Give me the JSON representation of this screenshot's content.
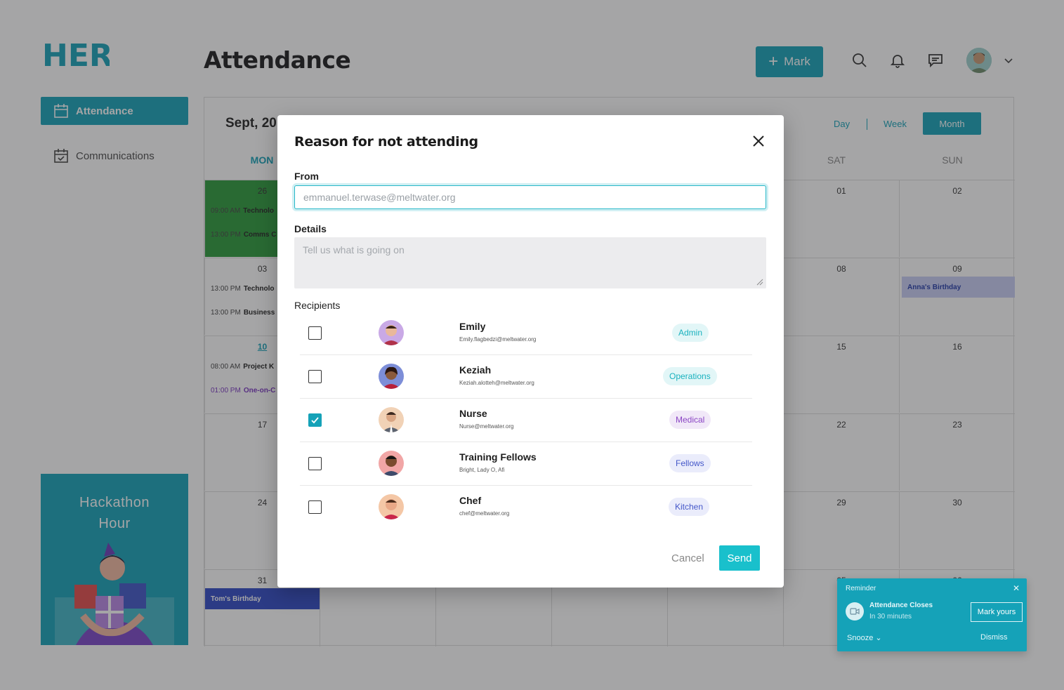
{
  "app": {
    "logo_text": "HERE",
    "page_title": "Attendance",
    "mark_button": "Mark",
    "brand_color": "#15a2b8",
    "header_icons": [
      "search-icon",
      "bell-icon",
      "chat-icon"
    ]
  },
  "sidebar": {
    "items": [
      {
        "label": "Attendance",
        "icon": "calendar-icon",
        "active": true
      },
      {
        "label": "Communications",
        "icon": "calendar-check-icon",
        "active": false
      }
    ],
    "promo_title_line1": "Hackathon",
    "promo_title_line2": "Hour"
  },
  "calendar": {
    "month_label": "Sept, 20",
    "views": {
      "day": "Day",
      "week": "Week",
      "month": "Month",
      "selected": "Month"
    },
    "weekdays": {
      "mon": "MON",
      "sat": "SAT",
      "sun": "SUN"
    },
    "mon_dates": [
      "26",
      "03",
      "10",
      "17",
      "24",
      "31"
    ],
    "sat_dates": [
      "01",
      "08",
      "15",
      "22",
      "29",
      "05"
    ],
    "sun_dates": [
      "02",
      "09",
      "16",
      "23",
      "30",
      "06"
    ],
    "events": [
      {
        "time": "09:00 AM",
        "title": "Technolo"
      },
      {
        "time": "13:00 PM",
        "title": "Comms C"
      },
      {
        "time": "13:00 PM",
        "title": "Technolo"
      },
      {
        "time": "13:00 PM",
        "title": "Business"
      },
      {
        "time": "08:00 AM",
        "title": "Project K"
      },
      {
        "time": "01:00 PM",
        "title": "One-on-C"
      }
    ],
    "birthdays": {
      "anna": "Anna's Birthday",
      "tom": "Tom's Birthday"
    }
  },
  "modal": {
    "title": "Reason for not attending",
    "from_label": "From",
    "from_placeholder": "emmanuel.terwase@meltwater.org",
    "details_label": "Details",
    "details_placeholder": "Tell us what is going on",
    "recipients_label": "Recipients",
    "recipients": [
      {
        "name": "Emily",
        "email": "Emily.flagbedzi@meltwater.org",
        "tag": "Admin",
        "checked": false,
        "tag_bg": "#e2f6f7",
        "tag_color": "#1ab2bf"
      },
      {
        "name": "Keziah",
        "email": "Keziah.alotteh@meltwater.org",
        "tag": "Operations",
        "checked": false,
        "tag_bg": "#e2f6f7",
        "tag_color": "#1ab2bf"
      },
      {
        "name": "Nurse",
        "email": "Nurse@meltwater.org",
        "tag": "Medical",
        "checked": true,
        "tag_bg": "#f1e8f8",
        "tag_color": "#8b46c4"
      },
      {
        "name": "Training Fellows",
        "email": "Bright, Lady O, Afi",
        "tag": "Fellows",
        "checked": false,
        "tag_bg": "#eaecfb",
        "tag_color": "#4457c9"
      },
      {
        "name": "Chef",
        "email": "chef@meltwater.org",
        "tag": "Kitchen",
        "checked": false,
        "tag_bg": "#eaecfb",
        "tag_color": "#4457c9"
      }
    ],
    "cancel_label": "Cancel",
    "send_label": "Send"
  },
  "toast": {
    "title": "Reminder",
    "main": "Attendance Closes",
    "sub": "In 30 minutes",
    "mark_label": "Mark yours",
    "snooze_label": "Snooze",
    "dismiss_label": "Dismiss"
  }
}
